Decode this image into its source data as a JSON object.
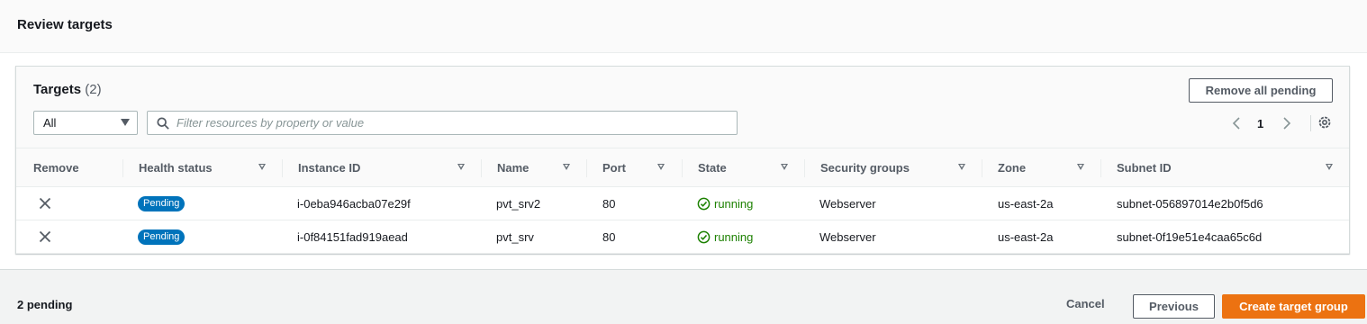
{
  "section": {
    "title": "Review targets"
  },
  "panel": {
    "title": "Targets",
    "count": "(2)",
    "remove_all_label": "Remove all pending",
    "filter_select": {
      "selected": "All"
    },
    "search": {
      "placeholder": "Filter resources by property or value",
      "value": ""
    },
    "pagination": {
      "current_page": "1"
    }
  },
  "table": {
    "columns": [
      "Remove",
      "Health status",
      "Instance ID",
      "Name",
      "Port",
      "State",
      "Security groups",
      "Zone",
      "Subnet ID"
    ],
    "rows": [
      {
        "health": "Pending",
        "instance_id": "i-0eba946acba07e29f",
        "name": "pvt_srv2",
        "port": "80",
        "state": "running",
        "security_groups": "Webserver",
        "zone": "us-east-2a",
        "subnet_id": "subnet-056897014e2b0f5d6"
      },
      {
        "health": "Pending",
        "instance_id": "i-0f84151fad919aead",
        "name": "pvt_srv",
        "port": "80",
        "state": "running",
        "security_groups": "Webserver",
        "zone": "us-east-2a",
        "subnet_id": "subnet-0f19e51e4caa65c6d"
      }
    ]
  },
  "footer": {
    "pending_text": "2 pending",
    "cancel_label": "Cancel",
    "previous_label": "Previous",
    "create_label": "Create target group"
  },
  "colors": {
    "accent": "#ec7211",
    "badge_blue": "#0073bb",
    "running_green": "#1d8102"
  },
  "icons": [
    "search-icon",
    "chevron-left-icon",
    "chevron-right-icon",
    "gear-icon",
    "close-icon",
    "check-circle-icon",
    "sort-icon",
    "caret-down-icon"
  ]
}
